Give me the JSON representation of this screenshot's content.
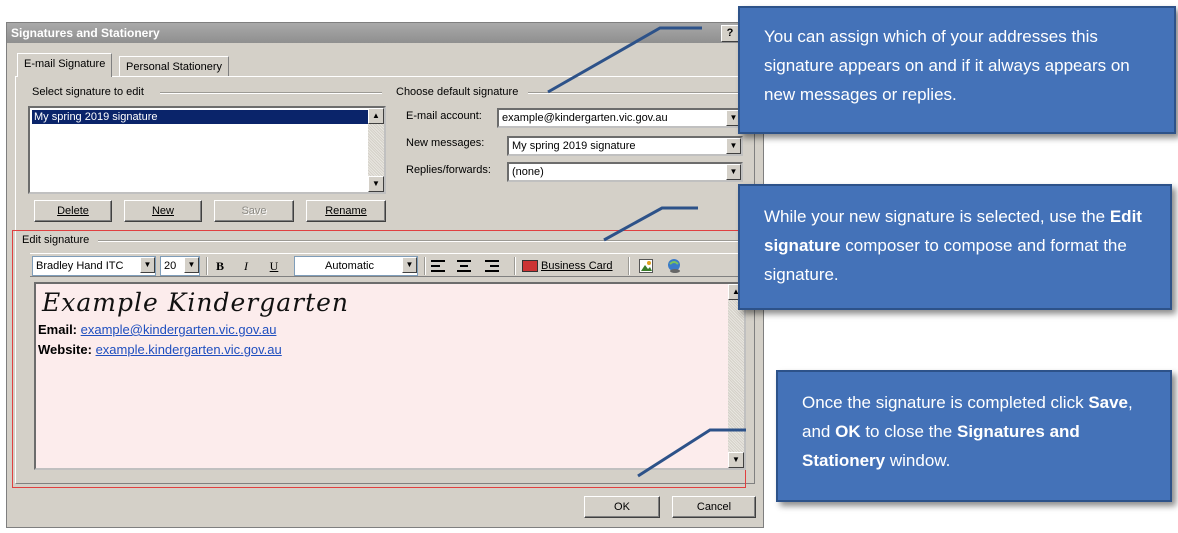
{
  "dialog": {
    "title": "Signatures and Stationery",
    "help_button": "?",
    "tabs": [
      "E-mail Signature",
      "Personal Stationery"
    ],
    "select_signature_label": "Select signature to edit",
    "signatures": [
      "My spring 2019 signature"
    ],
    "buttons": {
      "delete": "Delete",
      "new": "New",
      "save": "Save",
      "rename": "Rename",
      "ok": "OK",
      "cancel": "Cancel"
    },
    "default_signature": {
      "group_label": "Choose default signature",
      "email_account_label": "E-mail account:",
      "email_account_value": "example@kindergarten.vic.gov.au",
      "new_messages_label": "New messages:",
      "new_messages_value": "My spring 2019 signature",
      "replies_label": "Replies/forwards:",
      "replies_value": "(none)"
    },
    "edit_signature": {
      "group_label": "Edit signature",
      "font": "Bradley Hand ITC",
      "size": "20",
      "bold": "B",
      "italic": "I",
      "underline": "U",
      "color": "Automatic",
      "business_card": "Business Card",
      "content": {
        "heading": "Example Kindergarten",
        "email_label": "Email:",
        "email_value": "example@kindergarten.vic.gov.au",
        "website_label": "Website:",
        "website_value": "example.kindergarten.vic.gov.au"
      }
    }
  },
  "callouts": {
    "account": "You can assign which of your addresses this signature appears on and if it always appears on new messages or replies.",
    "compose": {
      "before": "While your new signature is selected, use the ",
      "bold": "Edit signature",
      "after": " composer to compose and format the signature."
    },
    "save": {
      "part1": "Once the signature is completed click ",
      "bold1": "Save",
      "part2": ", and ",
      "bold2": "OK",
      "part3": " to close the ",
      "bold3": "Signatures and Stationery",
      "part4": " window."
    }
  },
  "colors": {
    "callout_fill": "#4472b8",
    "selection": "#0a246a",
    "dialog_face": "#d4d0c8",
    "highlight_border": "#e04040"
  },
  "icons": [
    "align-left-icon",
    "align-center-icon",
    "align-right-icon",
    "business-card-icon",
    "insert-picture-icon",
    "insert-hyperlink-icon",
    "scroll-up-icon",
    "scroll-down-icon",
    "dropdown-arrow-icon"
  ]
}
